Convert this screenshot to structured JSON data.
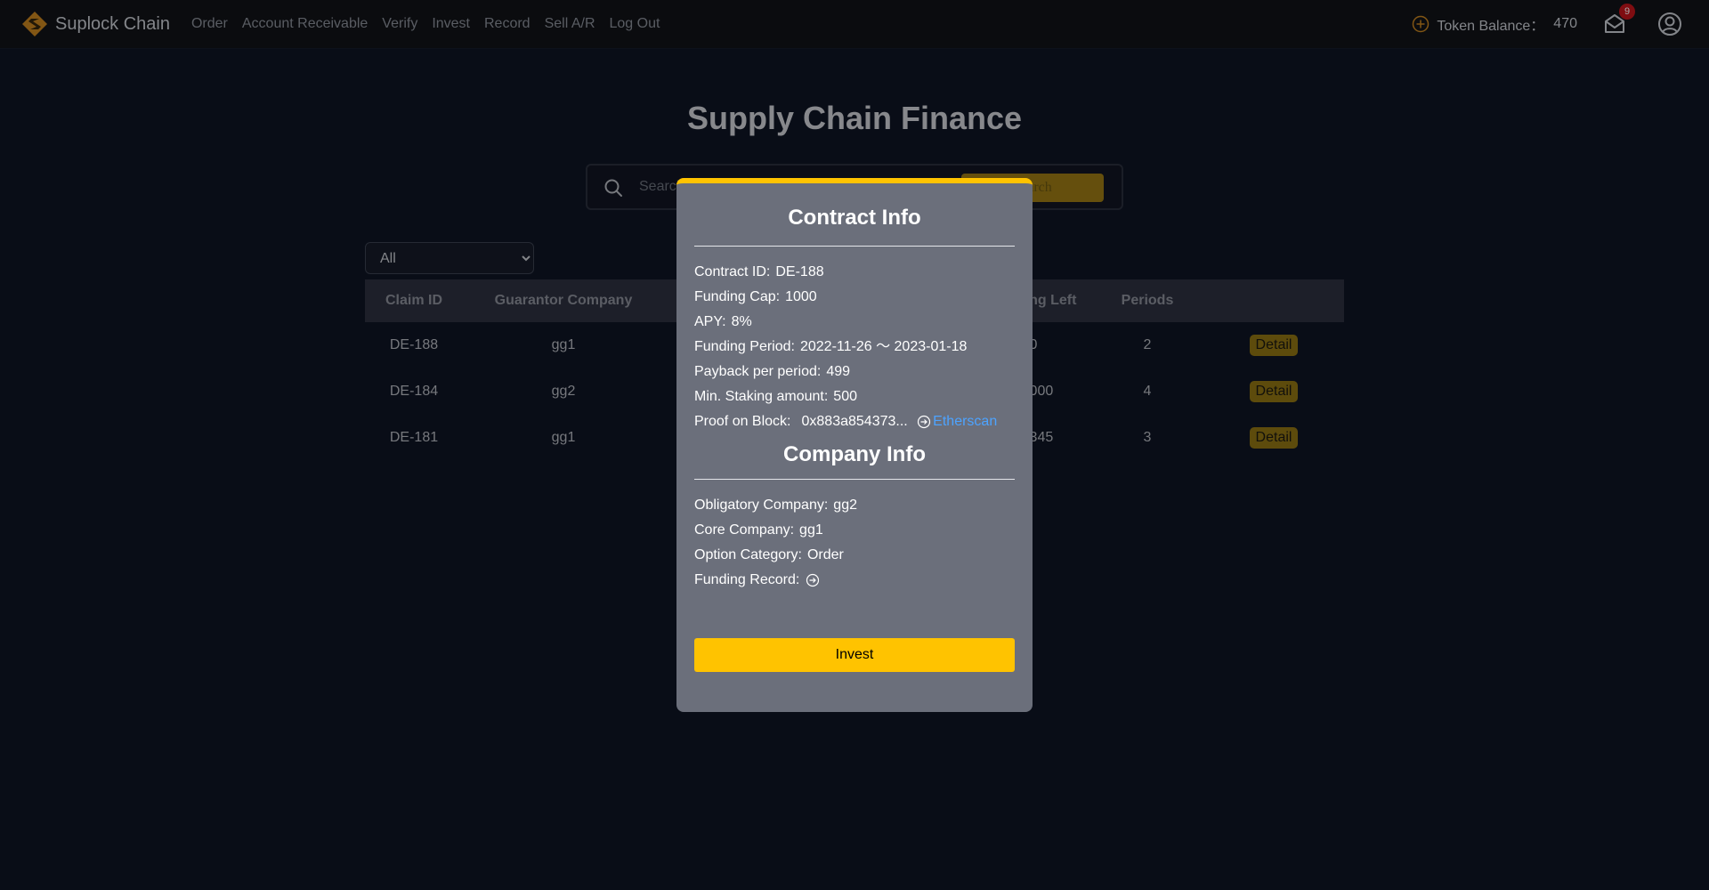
{
  "brand": {
    "name": "Suplock Chain"
  },
  "nav": {
    "links": [
      "Order",
      "Account Receivable",
      "Verify",
      "Invest",
      "Record",
      "Sell A/R",
      "Log Out"
    ]
  },
  "header_right": {
    "token_label": "Token Balance：",
    "token_value": "470",
    "mail_badge": "9"
  },
  "page": {
    "title": "Supply Chain Finance",
    "search": {
      "placeholder": "Search",
      "button_label": "Search"
    },
    "filter": {
      "selected": "All"
    }
  },
  "table": {
    "columns": [
      "Claim ID",
      "Guarantor Company",
      "",
      "",
      "",
      "Funding Left",
      "Periods",
      ""
    ],
    "rows": [
      {
        "claim_id": "DE-188",
        "guarantor": "gg1",
        "funding_left": "0",
        "periods": "2",
        "action": "Detail"
      },
      {
        "claim_id": "DE-184",
        "guarantor": "gg2",
        "funding_left": "10000",
        "periods": "4",
        "action": "Detail"
      },
      {
        "claim_id": "DE-181",
        "guarantor": "gg1",
        "funding_left": "12345",
        "periods": "3",
        "action": "Detail"
      }
    ]
  },
  "modal": {
    "contract_title": "Contract Info",
    "contract_id": {
      "label": "Contract ID:",
      "value": "DE-188"
    },
    "funding_cap": {
      "label": "Funding Cap:",
      "value": "1000"
    },
    "apy": {
      "label": "APY:",
      "value": "8%"
    },
    "funding_period": {
      "label": "Funding Period:",
      "value": "2022-11-26 ～ 2023-01-18"
    },
    "payback": {
      "label": "Payback per period:",
      "value": "499"
    },
    "min_staking": {
      "label": "Min. Staking amount:",
      "value": "500"
    },
    "proof": {
      "label": "Proof on Block:",
      "value": "0x883a854373...",
      "link_label": "Etherscan"
    },
    "company_title": "Company Info",
    "obligatory": {
      "label": "Obligatory Company:",
      "value": "gg2"
    },
    "core": {
      "label": "Core Company:",
      "value": "gg1"
    },
    "option_category": {
      "label": "Option Category:",
      "value": "Order"
    },
    "funding_record": {
      "label": "Funding Record:"
    },
    "invest_label": "Invest"
  },
  "colors": {
    "accent": "#ffc300",
    "link": "#4da3ff",
    "background": "#0e1424",
    "modal": "#6b6f7b"
  }
}
